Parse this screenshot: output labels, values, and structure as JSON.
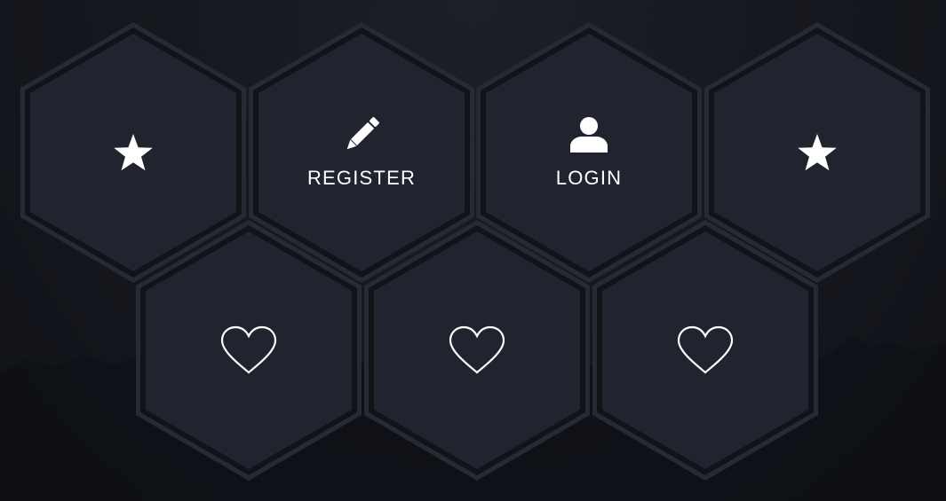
{
  "tiles": [
    {
      "id": "star-left",
      "icon": "star-icon",
      "label": ""
    },
    {
      "id": "register",
      "icon": "pencil-icon",
      "label": "REGISTER"
    },
    {
      "id": "login",
      "icon": "user-icon",
      "label": "LOGIN"
    },
    {
      "id": "star-right",
      "icon": "star-icon",
      "label": ""
    },
    {
      "id": "heart-1",
      "icon": "heart-icon",
      "label": ""
    },
    {
      "id": "heart-2",
      "icon": "heart-icon",
      "label": ""
    },
    {
      "id": "heart-3",
      "icon": "heart-icon",
      "label": ""
    }
  ],
  "colors": {
    "background": "#12141a",
    "tile_fill": "#20242f",
    "tile_outer_border": "#262a34",
    "tile_inner_border": "#111318",
    "icon": "#ffffff"
  }
}
